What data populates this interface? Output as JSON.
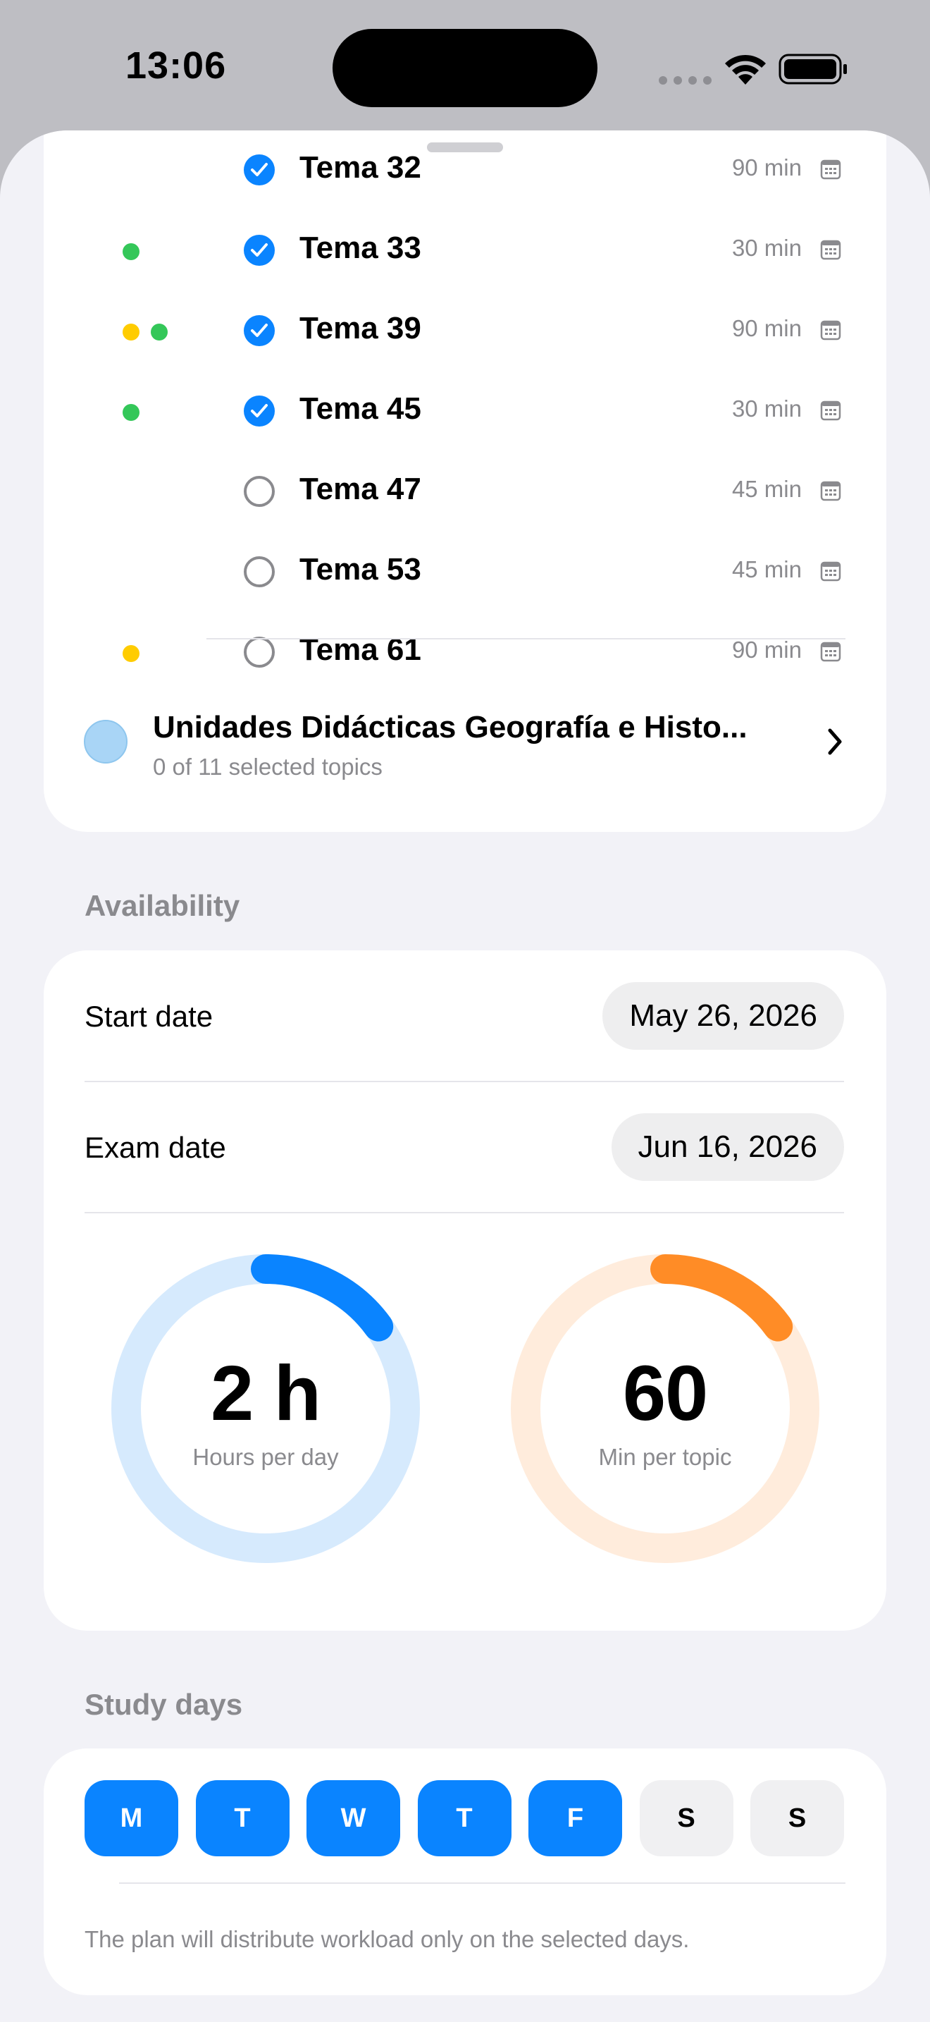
{
  "status_bar": {
    "time": "13:06"
  },
  "topics": [
    {
      "name": "Tema 32",
      "minutes": "90 min",
      "selected": true,
      "tags": []
    },
    {
      "name": "Tema 33",
      "minutes": "30 min",
      "selected": true,
      "tags": [
        "#34c759"
      ]
    },
    {
      "name": "Tema 39",
      "minutes": "90 min",
      "selected": true,
      "tags": [
        "#ffcc00",
        "#34c759"
      ]
    },
    {
      "name": "Tema 45",
      "minutes": "30 min",
      "selected": true,
      "tags": [
        "#34c759"
      ]
    },
    {
      "name": "Tema 47",
      "minutes": "45 min",
      "selected": false,
      "tags": []
    },
    {
      "name": "Tema 53",
      "minutes": "45 min",
      "selected": false,
      "tags": []
    },
    {
      "name": "Tema 61",
      "minutes": "90 min",
      "selected": false,
      "tags": [
        "#ffcc00"
      ]
    }
  ],
  "subject": {
    "title": "Unidades Didácticas Geografía e Histo...",
    "subtitle": "0 of 11 selected topics",
    "color": "#a9d5f6"
  },
  "availability": {
    "header": "Availability",
    "start_label": "Start date",
    "start_value": "May 26, 2026",
    "exam_label": "Exam date",
    "exam_value": "Jun 16, 2026",
    "hours_value": "2 h",
    "hours_label": "Hours per day",
    "hours_progress": 0.15,
    "minutes_value": "60",
    "minutes_label": "Min per topic",
    "minutes_progress": 0.15
  },
  "study_days": {
    "header": "Study days",
    "days": [
      {
        "label": "M",
        "selected": true
      },
      {
        "label": "T",
        "selected": true
      },
      {
        "label": "W",
        "selected": true
      },
      {
        "label": "T",
        "selected": true
      },
      {
        "label": "F",
        "selected": true
      },
      {
        "label": "S",
        "selected": false
      },
      {
        "label": "S",
        "selected": false
      }
    ],
    "note": "The plan will distribute workload only on the selected days."
  },
  "colors": {
    "accent": "#0a84ff",
    "orange": "#ff8c26",
    "green": "#34c759",
    "yellow": "#ffcc00"
  }
}
